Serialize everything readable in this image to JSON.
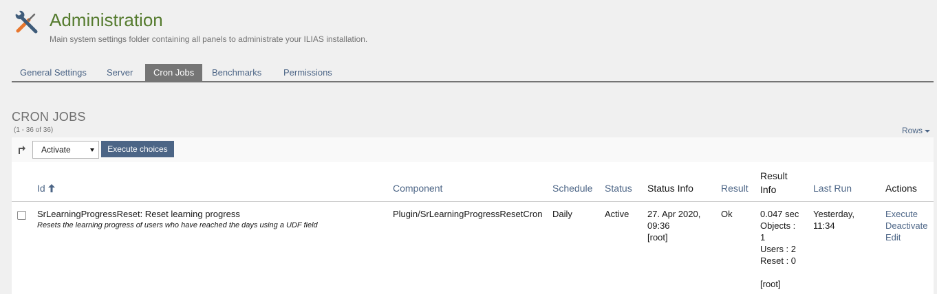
{
  "header": {
    "icon": "tools-icon",
    "title": "Administration",
    "description": "Main system settings folder containing all panels to administrate your ILIAS installation."
  },
  "tabs": [
    {
      "label": "General Settings",
      "active": false
    },
    {
      "label": "Server",
      "active": false
    },
    {
      "label": "Cron Jobs",
      "active": true
    },
    {
      "label": "Benchmarks",
      "active": false
    },
    {
      "label": "Permissions",
      "active": false
    }
  ],
  "section": {
    "title": "CRON JOBS",
    "count": "(1 - 36 of 36)",
    "rows_label": "Rows"
  },
  "toolbar": {
    "select_value": "Activate",
    "execute_label": "Execute choices"
  },
  "table": {
    "columns": {
      "id": "Id",
      "component": "Component",
      "schedule": "Schedule",
      "status": "Status",
      "status_info": "Status Info",
      "result": "Result",
      "result_info_1": "Result",
      "result_info_2": "Info",
      "last_run": "Last Run",
      "actions": "Actions"
    },
    "row": {
      "title": "SrLearningProgressReset: Reset learning progress",
      "description": "Resets the learning progress of users who have reached the days using a UDF field",
      "component": "Plugin/SrLearningProgressResetCron",
      "schedule": "Daily",
      "status": "Active",
      "status_info": [
        "27. Apr 2020,",
        "09:36",
        "[root]"
      ],
      "result": "Ok",
      "result_info": [
        "0.047 sec",
        "Objects :",
        "1",
        "Users : 2",
        "Reset : 0",
        "",
        "[root]"
      ],
      "last_run": [
        "Yesterday,",
        "11:34"
      ],
      "actions": [
        "Execute",
        "Deactivate",
        "Edit"
      ]
    }
  },
  "colors": {
    "title_green": "#557b2e",
    "link_blue": "#4c6586",
    "tab_active": "#757575"
  }
}
